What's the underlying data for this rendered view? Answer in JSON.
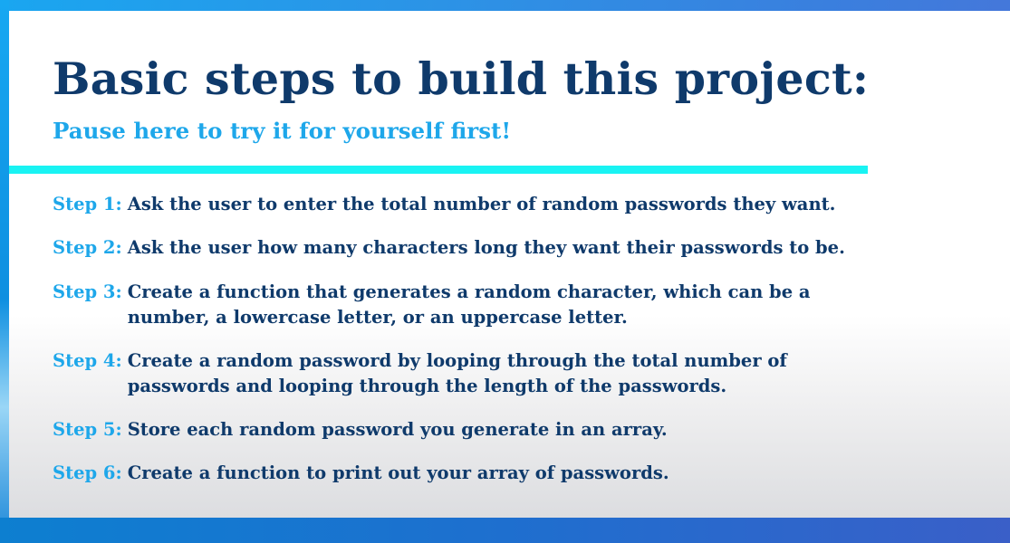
{
  "slide": {
    "title": "Basic steps to build this project:",
    "subtitle": "Pause here to try it for yourself first!",
    "steps": [
      {
        "label": "Step 1:",
        "text": "Ask the user to enter the total number of random passwords they want."
      },
      {
        "label": "Step 2:",
        "text": "Ask the user how many characters long they want their passwords to be."
      },
      {
        "label": "Step 3:",
        "text": "Create a function that generates a random character, which can be a\nnumber, a lowercase letter, or an uppercase letter."
      },
      {
        "label": "Step 4:",
        "text": "Create a random password by looping through the total number of\npasswords and looping through the length of the passwords."
      },
      {
        "label": "Step 5:",
        "text": "Store each random password you generate in an array."
      },
      {
        "label": "Step 6:",
        "text": "Create a function to print out your array of passwords."
      }
    ]
  },
  "colors": {
    "title": "#0f3a6b",
    "accent": "#1ea7ea",
    "divider": "#19f3f3",
    "frame": "#1aa6f0"
  }
}
